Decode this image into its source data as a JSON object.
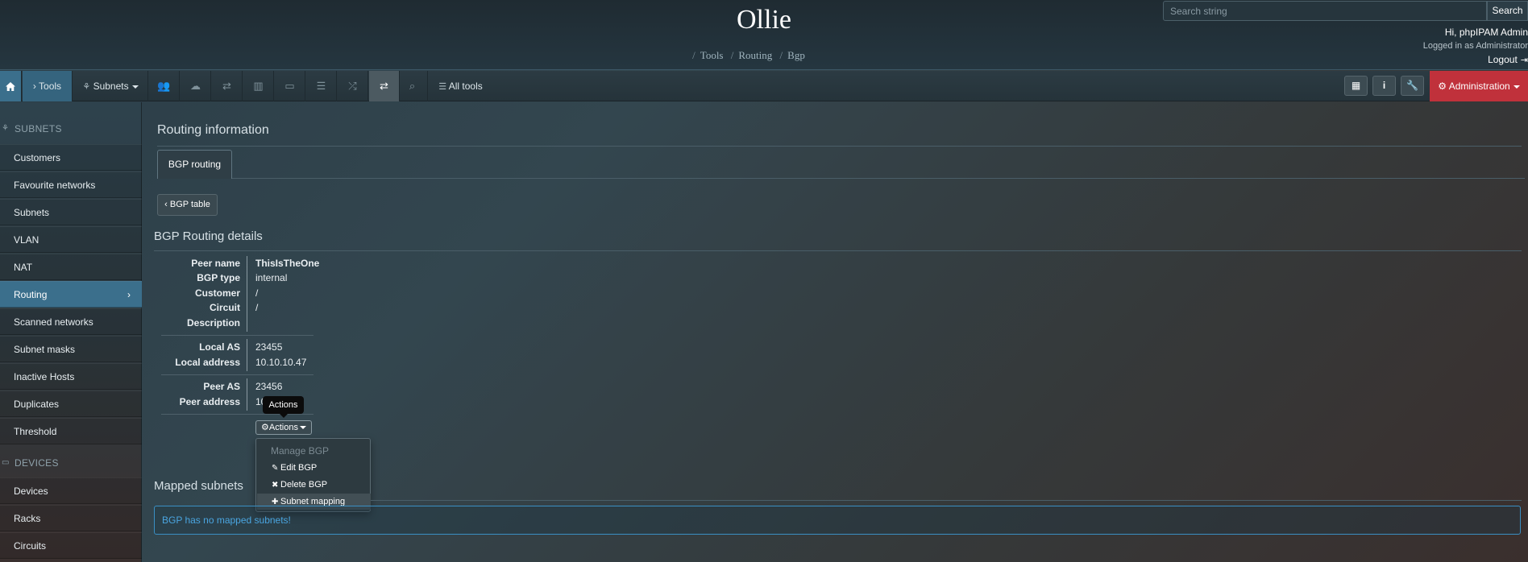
{
  "header": {
    "title": "Ollie",
    "breadcrumb": [
      "Tools",
      "Routing",
      "Bgp"
    ],
    "search_placeholder": "Search string",
    "search_button": "Search",
    "greeting": "Hi, phpIPAM Admin",
    "logged_in_as": "Logged in as  Administrator",
    "logout": "Logout"
  },
  "navbar": {
    "tools_label": "› Tools",
    "subnets_label": "Subnets",
    "all_tools_label": "All tools",
    "admin_label": "Administration"
  },
  "sidebar": {
    "subnets_header": "SUBNETS",
    "devices_header": "DEVICES",
    "items": [
      {
        "label": "Customers"
      },
      {
        "label": "Favourite networks"
      },
      {
        "label": "Subnets"
      },
      {
        "label": "VLAN"
      },
      {
        "label": "NAT"
      },
      {
        "label": "Routing",
        "active": true
      },
      {
        "label": "Scanned networks"
      },
      {
        "label": "Subnet masks"
      },
      {
        "label": "Inactive Hosts"
      },
      {
        "label": "Duplicates"
      },
      {
        "label": "Threshold"
      }
    ],
    "device_items": [
      {
        "label": "Devices"
      },
      {
        "label": "Racks"
      },
      {
        "label": "Circuits"
      }
    ]
  },
  "main": {
    "title": "Routing information",
    "tab": "BGP routing",
    "back_button": "‹ BGP table",
    "details_title": "BGP Routing details",
    "details": {
      "peer_name_label": "Peer name",
      "peer_name": "ThisIsTheOne",
      "bgp_type_label": "BGP type",
      "bgp_type": "internal",
      "customer_label": "Customer",
      "customer": "/",
      "circuit_label": "Circuit",
      "circuit": "/",
      "description_label": "Description",
      "description": "",
      "local_as_label": "Local AS",
      "local_as": "23455",
      "local_address_label": "Local address",
      "local_address": "10.10.10.47",
      "peer_as_label": "Peer AS",
      "peer_as": "23456",
      "peer_address_label": "Peer address",
      "peer_address": "10"
    },
    "actions_button": "Actions",
    "tooltip": "Actions",
    "dropdown": {
      "header": "Manage BGP",
      "items": [
        "Edit BGP",
        "Delete BGP",
        "Subnet mapping"
      ]
    },
    "mapped_title": "Mapped subnets",
    "mapped_alert": "BGP has no mapped subnets!"
  }
}
